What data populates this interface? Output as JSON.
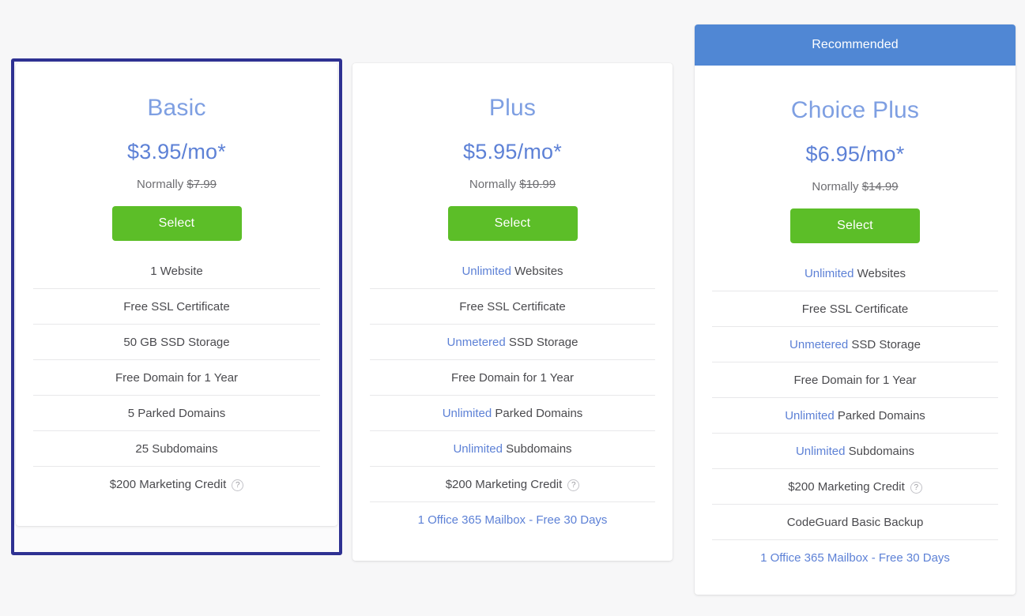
{
  "theme": {
    "page_background": "#f7f7f8",
    "card_background": "#ffffff",
    "selected_border": "#2e3192",
    "recommended_banner": "#5087d4",
    "select_button": "#5cbe28",
    "plan_name_color": "#7e9fe2",
    "price_color": "#5d81d6",
    "highlight_color": "#5d81d6",
    "feature_text_color": "#4a4a4e",
    "divider_color": "#e8e8ea"
  },
  "plans": [
    {
      "id": "basic",
      "name": "Basic",
      "price": "$3.95/mo*",
      "normally_label": "Normally",
      "normally_price": "$7.99",
      "select_label": "Select",
      "selected": true,
      "recommended": false,
      "recommended_label": "",
      "features": [
        {
          "highlight": "",
          "text": "1 Website",
          "help": false,
          "link": false
        },
        {
          "highlight": "",
          "text": "Free SSL Certificate",
          "help": false,
          "link": false
        },
        {
          "highlight": "",
          "text": "50 GB SSD Storage",
          "help": false,
          "link": false
        },
        {
          "highlight": "",
          "text": "Free Domain for 1 Year",
          "help": false,
          "link": false
        },
        {
          "highlight": "",
          "text": "5 Parked Domains",
          "help": false,
          "link": false
        },
        {
          "highlight": "",
          "text": "25 Subdomains",
          "help": false,
          "link": false
        },
        {
          "highlight": "",
          "text": "$200 Marketing Credit",
          "help": true,
          "link": false
        }
      ]
    },
    {
      "id": "plus",
      "name": "Plus",
      "price": "$5.95/mo*",
      "normally_label": "Normally",
      "normally_price": "$10.99",
      "select_label": "Select",
      "selected": false,
      "recommended": false,
      "recommended_label": "",
      "features": [
        {
          "highlight": "Unlimited",
          "text": " Websites",
          "help": false,
          "link": false
        },
        {
          "highlight": "",
          "text": "Free SSL Certificate",
          "help": false,
          "link": false
        },
        {
          "highlight": "Unmetered",
          "text": " SSD Storage",
          "help": false,
          "link": false
        },
        {
          "highlight": "",
          "text": "Free Domain for 1 Year",
          "help": false,
          "link": false
        },
        {
          "highlight": "Unlimited",
          "text": " Parked Domains",
          "help": false,
          "link": false
        },
        {
          "highlight": "Unlimited",
          "text": " Subdomains",
          "help": false,
          "link": false
        },
        {
          "highlight": "",
          "text": "$200 Marketing Credit",
          "help": true,
          "link": false
        },
        {
          "highlight": "",
          "text": "1 Office 365 Mailbox - Free 30 Days",
          "help": false,
          "link": true
        }
      ]
    },
    {
      "id": "choice-plus",
      "name": "Choice Plus",
      "price": "$6.95/mo*",
      "normally_label": "Normally",
      "normally_price": "$14.99",
      "select_label": "Select",
      "selected": false,
      "recommended": true,
      "recommended_label": "Recommended",
      "features": [
        {
          "highlight": "Unlimited",
          "text": " Websites",
          "help": false,
          "link": false
        },
        {
          "highlight": "",
          "text": "Free SSL Certificate",
          "help": false,
          "link": false
        },
        {
          "highlight": "Unmetered",
          "text": " SSD Storage",
          "help": false,
          "link": false
        },
        {
          "highlight": "",
          "text": "Free Domain for 1 Year",
          "help": false,
          "link": false
        },
        {
          "highlight": "Unlimited",
          "text": " Parked Domains",
          "help": false,
          "link": false
        },
        {
          "highlight": "Unlimited",
          "text": " Subdomains",
          "help": false,
          "link": false
        },
        {
          "highlight": "",
          "text": "$200 Marketing Credit",
          "help": true,
          "link": false
        },
        {
          "highlight": "",
          "text": "CodeGuard Basic Backup",
          "help": false,
          "link": false
        },
        {
          "highlight": "",
          "text": "1 Office 365 Mailbox - Free 30 Days",
          "help": false,
          "link": true
        }
      ]
    }
  ],
  "icons": {
    "help": "?"
  }
}
